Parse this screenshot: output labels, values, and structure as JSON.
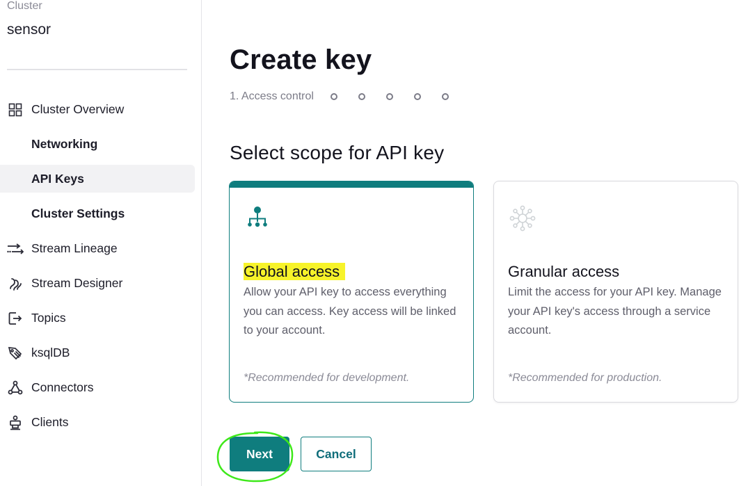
{
  "sidebar": {
    "cluster_label": "Cluster",
    "cluster_name": "sensor",
    "items": [
      {
        "label": "Cluster Overview",
        "icon": "grid-icon"
      },
      {
        "label": "Networking",
        "icon": ""
      },
      {
        "label": "API Keys",
        "icon": ""
      },
      {
        "label": "Cluster Settings",
        "icon": ""
      },
      {
        "label": "Stream Lineage",
        "icon": "stream-lineage-icon"
      },
      {
        "label": "Stream Designer",
        "icon": "stream-designer-icon"
      },
      {
        "label": "Topics",
        "icon": "topics-icon"
      },
      {
        "label": "ksqlDB",
        "icon": "ksqldb-icon"
      },
      {
        "label": "Connectors",
        "icon": "connectors-icon"
      },
      {
        "label": "Clients",
        "icon": "clients-icon"
      }
    ],
    "active_item": "API Keys"
  },
  "main": {
    "title": "Create key",
    "stepper": {
      "current_label": "1. Access control",
      "remaining_steps": 5
    },
    "section_title": "Select scope for API key",
    "cards": [
      {
        "title": "Global access",
        "description": "Allow your API key to access everything you can access. Key access will be linked to your account.",
        "note": "*Recommended for development.",
        "icon": "hierarchy-icon",
        "selected": true
      },
      {
        "title": "Granular access",
        "description": "Limit the access for your API key. Manage your API key's access through a service account.",
        "note": "*Recommended for production.",
        "icon": "network-hub-icon",
        "selected": false
      }
    ],
    "buttons": {
      "next": "Next",
      "cancel": "Cancel"
    }
  },
  "colors": {
    "accent": "#0f7d7e",
    "highlight": "#f7f32a",
    "annotation": "#3ee81a"
  }
}
